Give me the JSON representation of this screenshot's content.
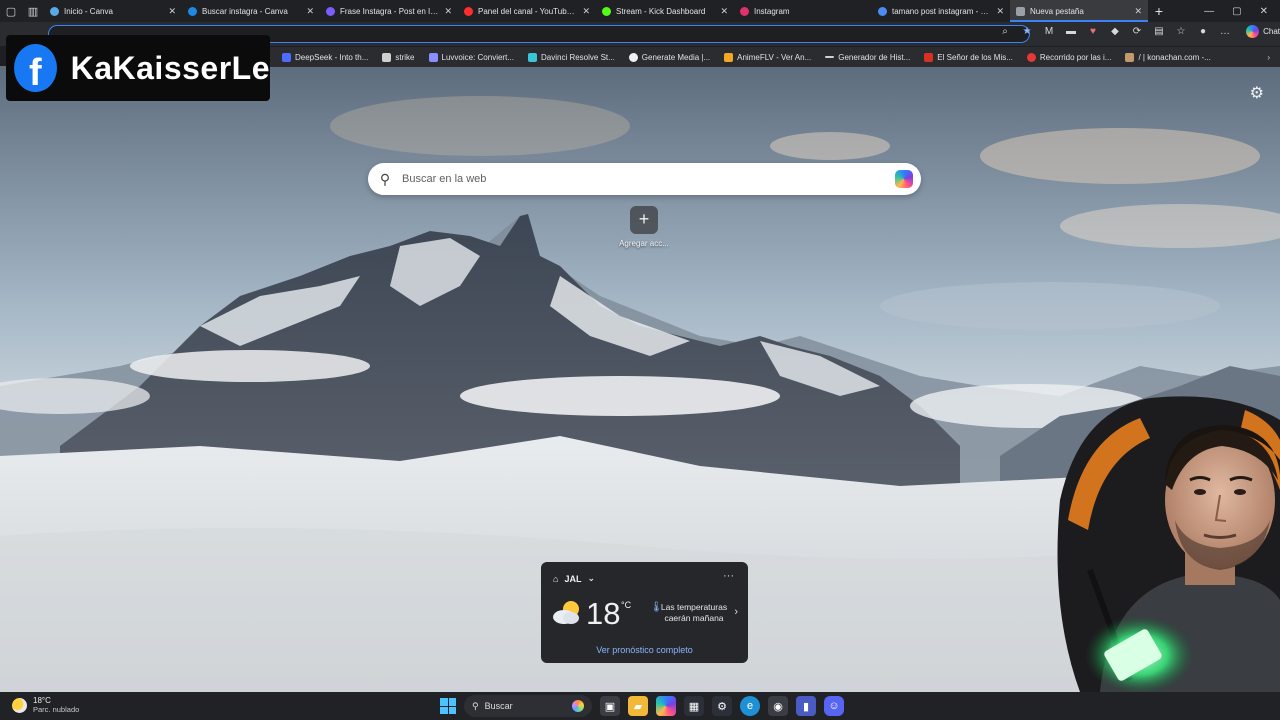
{
  "tabs": [
    {
      "title": "Inicio - Canva",
      "color": "#5aa9e6"
    },
    {
      "title": "Buscar instagra - Canva",
      "color": "#1e88e5"
    },
    {
      "title": "Frase Instagra - Post en Instagr",
      "color": "#7c5cff"
    },
    {
      "title": "Panel del canal - YouTube Studi",
      "color": "#ff2d2d"
    },
    {
      "title": "Stream - Kick Dashboard",
      "color": "#53fc18"
    },
    {
      "title": "Instagram",
      "color": "#e1306c"
    },
    {
      "title": "tamano post instagram - Búsq",
      "color": "#4c8bf5"
    },
    {
      "title": "Nueva pestaña",
      "color": "#9aa0a6",
      "active": true
    }
  ],
  "bookmarks": [
    {
      "label": "DeepSeek - Into th...",
      "color": "#4d6bfe"
    },
    {
      "label": "strike",
      "color": "#cfcfcf"
    },
    {
      "label": "Luvvoice: Conviert...",
      "color": "#8a8fff"
    },
    {
      "label": "Davinci Resolve St...",
      "color": "#39c6d9"
    },
    {
      "label": "Generate Media |...",
      "color": "#f0f0f0"
    },
    {
      "label": "AnimeFLV - Ver An...",
      "color": "#f5a623"
    },
    {
      "label": "Generador de Hist...",
      "color": "#d0d0d0"
    },
    {
      "label": "El Señor de los Mis...",
      "color": "#d93025"
    },
    {
      "label": "Recorrido por las i...",
      "color": "#e53935"
    },
    {
      "label": "/ | konachan.com -...",
      "color": "#c49a6c"
    }
  ],
  "overlay": {
    "text": "KaKaisserLe"
  },
  "search": {
    "placeholder": "Buscar en la web"
  },
  "quicklink": {
    "label": "Agregar acc..."
  },
  "weather": {
    "location": "JAL",
    "temp": "18",
    "unit": "°C",
    "note": "Las temperaturas caerán mañana",
    "link": "Ver pronóstico completo"
  },
  "taskbar": {
    "temp": "18°C",
    "condition": "Parc. nublado",
    "search": "Buscar"
  },
  "addrbar": {
    "chat": "Chat"
  }
}
